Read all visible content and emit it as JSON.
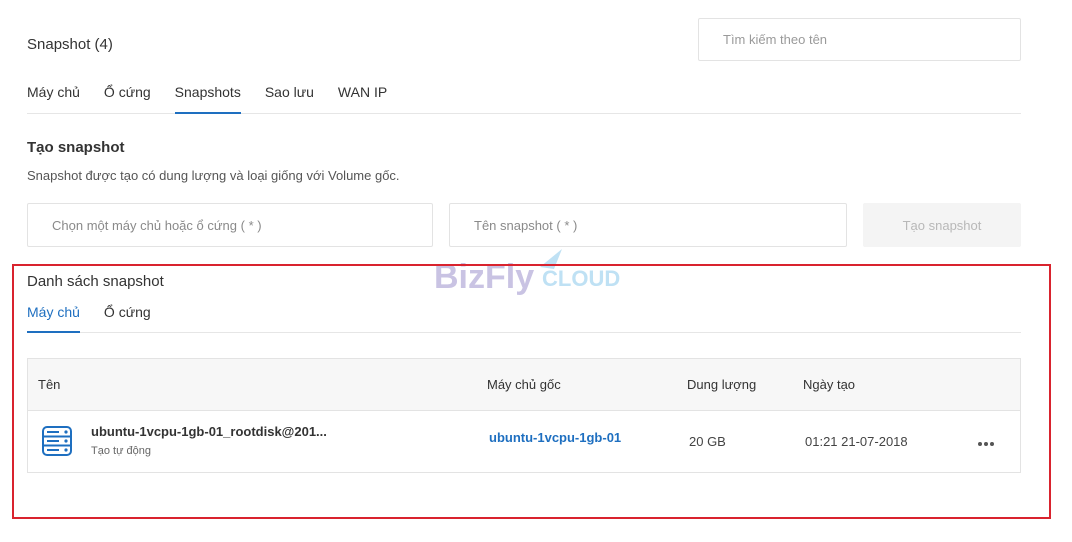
{
  "header": {
    "title": "Snapshot (4)",
    "search_placeholder": "Tìm kiếm theo tên"
  },
  "top_tabs": [
    {
      "label": "Máy chủ",
      "active": false
    },
    {
      "label": "Ổ cứng",
      "active": false
    },
    {
      "label": "Snapshots",
      "active": true
    },
    {
      "label": "Sao lưu",
      "active": false
    },
    {
      "label": "WAN IP",
      "active": false
    }
  ],
  "create": {
    "title": "Tạo snapshot",
    "description": "Snapshot được tạo có dung lượng và loại giống với Volume gốc.",
    "server_placeholder": "Chọn một máy chủ hoặc ổ cứng ( * )",
    "name_placeholder": "Tên snapshot ( * )",
    "button_label": "Tạo snapshot"
  },
  "watermark": {
    "part1": "BizFly",
    "part2": "CLOUD"
  },
  "list": {
    "title": "Danh sách snapshot",
    "tabs": [
      {
        "label": "Máy chủ",
        "active": true
      },
      {
        "label": "Ổ cứng",
        "active": false
      }
    ],
    "columns": {
      "name": "Tên",
      "origin_server": "Máy chủ gốc",
      "size": "Dung lượng",
      "created": "Ngày tạo"
    },
    "rows": [
      {
        "icon": "server-icon",
        "name": "ubuntu-1vcpu-1gb-01_rootdisk@201...",
        "subtitle": "Tạo tự động",
        "origin_server": "ubuntu-1vcpu-1gb-01",
        "size": "20 GB",
        "created": "01:21 21-07-2018"
      }
    ]
  },
  "colors": {
    "accent": "#1e6fc0",
    "highlight_border": "#d9232e",
    "watermark_purple": "#c9c3e3",
    "watermark_blue": "#bfe1f4"
  }
}
